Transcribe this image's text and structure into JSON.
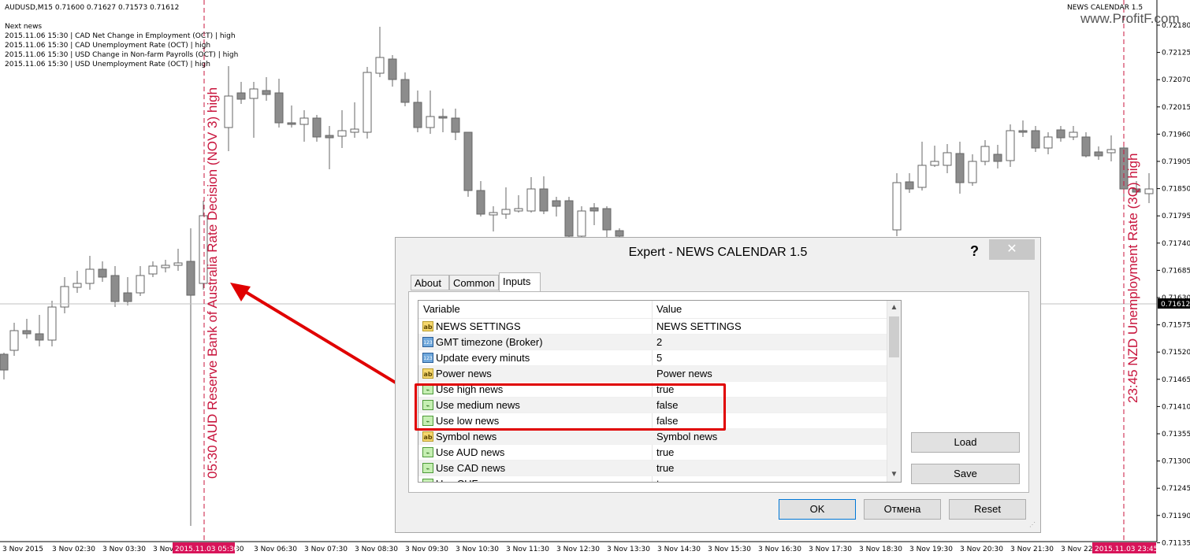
{
  "chart": {
    "header": "AUDUSD,M15  0.71600 0.71627 0.71573 0.71612",
    "indicator_label": "NEWS CALENDAR 1.5",
    "watermark": "www.ProfitF.com",
    "next_news_title": "Next news",
    "next_news": [
      "2015.11.06  15:30 | CAD Net Change in Employment (OCT) | high",
      "2015.11.06  15:30 | CAD Unemployment Rate (OCT) | high",
      "2015.11.06  15:30 | USD Change in Non-farm Payrolls (OCT) | high",
      "2015.11.06  15:30 | USD Unemployment Rate (OCT) | high"
    ],
    "event_left": "05:30 AUD Reserve Bank of Australia Rate Decision (NOV 3) high",
    "event_right": "23:45 NZD Unemployment Rate (3Q) high",
    "price_labels": [
      "0.72180",
      "0.72125",
      "0.72070",
      "0.72015",
      "0.71960",
      "0.71905",
      "0.71850",
      "0.71795",
      "0.71740",
      "0.71685",
      "0.71630",
      "0.71575",
      "0.71520",
      "0.71465",
      "0.71410",
      "0.71355",
      "0.71300",
      "0.71245",
      "0.71190",
      "0.71135"
    ],
    "current_price": "0.71612",
    "time_labels": [
      "3 Nov 2015",
      "3 Nov 02:30",
      "3 Nov 03:30",
      "3 Nov",
      "30",
      "3 Nov 06:30",
      "3 Nov 07:30",
      "3 Nov 08:30",
      "3 Nov 09:30",
      "3 Nov 10:30",
      "3 Nov 11:30",
      "3 Nov 12:30",
      "3 Nov 13:30",
      "3 Nov 14:30",
      "3 Nov 15:30",
      "3 Nov 16:30",
      "3 Nov 17:30",
      "3 Nov 18:30",
      "3 Nov 19:30",
      "3 Nov 20:30",
      "3 Nov 21:30",
      "3 Nov 22"
    ],
    "time_marker_left": "2015.11.03 05:30",
    "time_marker_right": "2015.11.03 23:45",
    "colors": {
      "event_line": "#c8143c",
      "marker_bg": "#d8145a",
      "arrow": "#e00000",
      "candle": "#8c8c8c"
    }
  },
  "dialog": {
    "title": "Expert - NEWS CALENDAR 1.5",
    "help": "?",
    "close": "✕",
    "tabs": [
      "About",
      "Common",
      "Inputs"
    ],
    "active_tab": "Inputs",
    "columns": [
      "Variable",
      "Value"
    ],
    "rows": [
      {
        "icon": "ab",
        "name": "NEWS SETTINGS",
        "value": "NEWS SETTINGS"
      },
      {
        "icon": "123",
        "name": "GMT timezone (Broker)",
        "value": "2"
      },
      {
        "icon": "123",
        "name": "Update every minuts",
        "value": "5"
      },
      {
        "icon": "ab",
        "name": "Power news",
        "value": "Power news"
      },
      {
        "icon": "bool",
        "name": "Use high news",
        "value": "true"
      },
      {
        "icon": "bool",
        "name": "Use medium news",
        "value": "false"
      },
      {
        "icon": "bool",
        "name": "Use low news",
        "value": "false"
      },
      {
        "icon": "ab",
        "name": "Symbol news",
        "value": "Symbol news"
      },
      {
        "icon": "bool",
        "name": "Use AUD news",
        "value": "true"
      },
      {
        "icon": "bool",
        "name": "Use CAD news",
        "value": "true"
      },
      {
        "icon": "bool",
        "name": "Use CHF news",
        "value": "true"
      }
    ],
    "load_label": "Load",
    "save_label": "Save",
    "ok_label": "OK",
    "cancel_label": "Отмена",
    "reset_label": "Reset"
  }
}
